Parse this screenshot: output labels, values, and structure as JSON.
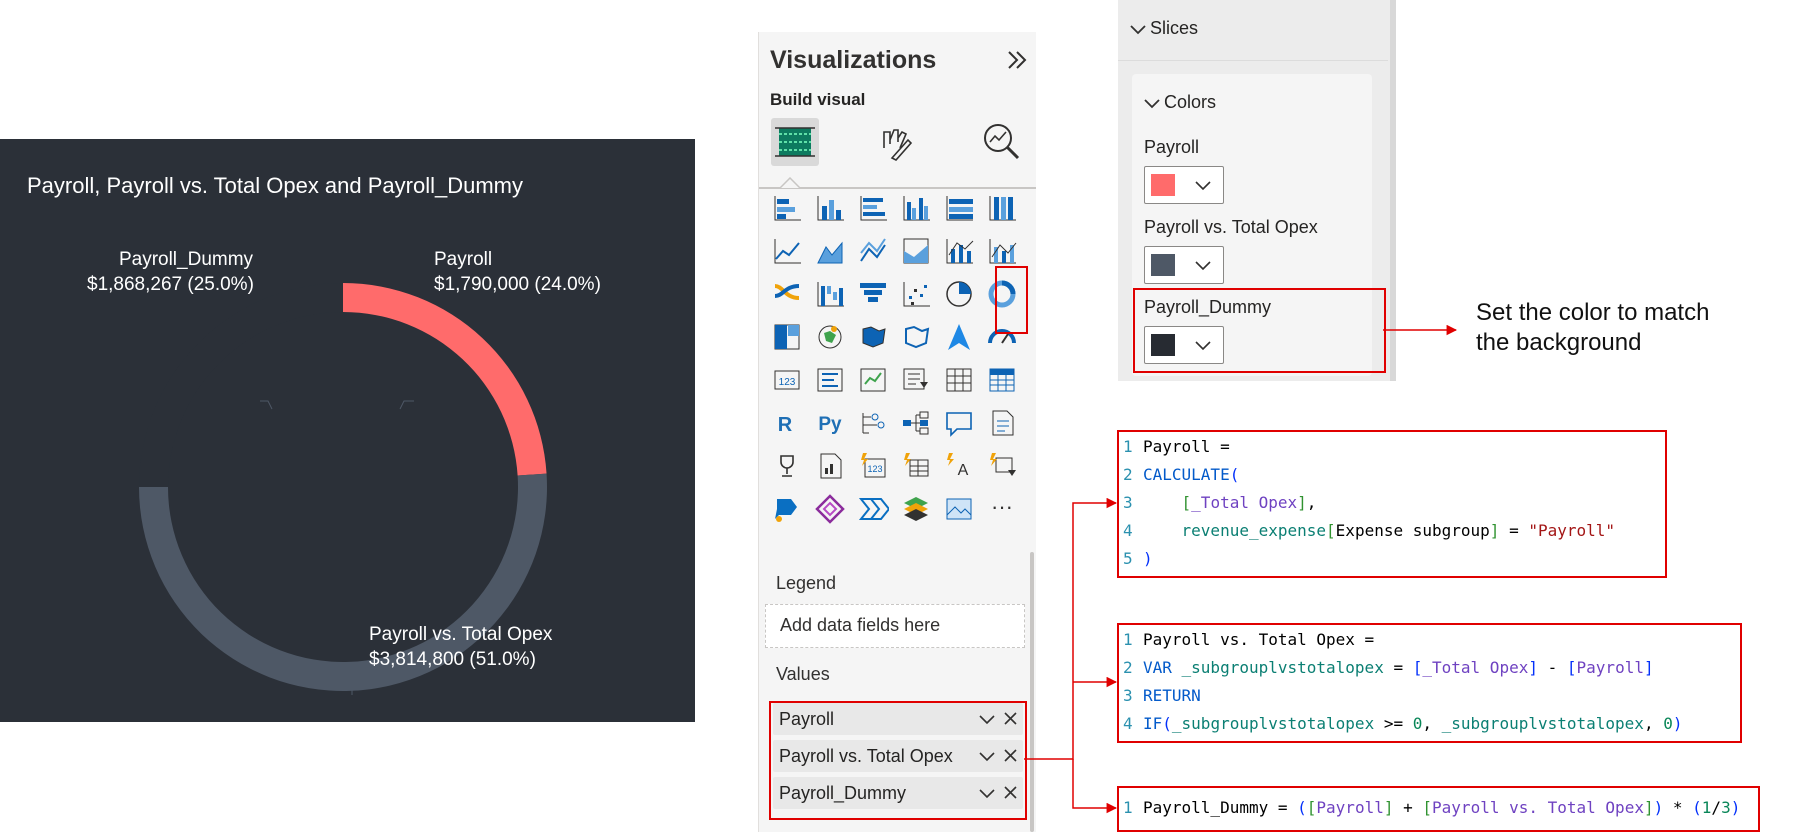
{
  "chart": {
    "title": "Payroll, Payroll vs. Total Opex and Payroll_Dummy",
    "labels": {
      "payroll_dummy": {
        "name": "Payroll_Dummy",
        "value": "$1,868,267 (25.0%)"
      },
      "payroll": {
        "name": "Payroll",
        "value": "$1,790,000 (24.0%)"
      },
      "payroll_vs_opex": {
        "name": "Payroll vs. Total Opex",
        "value": "$3,814,800 (51.0%)"
      }
    }
  },
  "chart_data": {
    "type": "pie",
    "title": "Payroll, Payroll vs. Total Opex and Payroll_Dummy",
    "categories": [
      "Payroll",
      "Payroll vs. Total Opex",
      "Payroll_Dummy"
    ],
    "values": [
      1790000,
      3814800,
      1868267
    ],
    "percentages": [
      24.0,
      51.0,
      25.0
    ],
    "colors": [
      "#ff6b6b",
      "#4e5866",
      "#2b3038"
    ],
    "legend": "none"
  },
  "viz_pane": {
    "title": "Visualizations",
    "build_visual": "Build visual",
    "legend_label": "Legend",
    "add_fields": "Add data fields here",
    "values_label": "Values",
    "value_fields": [
      "Payroll",
      "Payroll vs. Total Opex",
      "Payroll_Dummy"
    ],
    "more": "···",
    "icon_r": "R",
    "icon_py": "Py",
    "icon_123": "123"
  },
  "format_pane": {
    "slices": "Slices",
    "colors": "Colors",
    "items": [
      {
        "label": "Payroll",
        "color": "#ff6b6b"
      },
      {
        "label": "Payroll vs. Total Opex",
        "color": "#4e5866"
      },
      {
        "label": "Payroll_Dummy",
        "color": "#272b32"
      }
    ]
  },
  "annotation": {
    "line1": "Set the color to match",
    "line2": "the background"
  },
  "code": {
    "block1": {
      "lines": [
        {
          "n": "1",
          "segs": [
            [
              "p",
              "Payroll ="
            ]
          ]
        },
        {
          "n": "2",
          "segs": [
            [
              "f",
              "CALCULATE"
            ],
            [
              "b1",
              "("
            ]
          ]
        },
        {
          "n": "3",
          "segs": [
            [
              "p",
              "    "
            ],
            [
              "b2",
              "["
            ],
            [
              "m",
              "_Total Opex"
            ],
            [
              "b2",
              "]"
            ],
            [
              "p",
              ","
            ]
          ]
        },
        {
          "n": "4",
          "segs": [
            [
              "p",
              "    "
            ],
            [
              "t",
              "revenue_expense"
            ],
            [
              "b2",
              "["
            ],
            [
              "p",
              "Expense subgroup"
            ],
            [
              "b2",
              "]"
            ],
            [
              "p",
              " = "
            ],
            [
              "s",
              "\"Payroll\""
            ]
          ]
        },
        {
          "n": "5",
          "segs": [
            [
              "b1",
              ")"
            ]
          ]
        }
      ]
    },
    "block2": {
      "lines": [
        {
          "n": "1",
          "segs": [
            [
              "p",
              "Payroll vs. Total Opex ="
            ]
          ]
        },
        {
          "n": "2",
          "segs": [
            [
              "k",
              "VAR "
            ],
            [
              "t",
              "_subgrouplvstotalopex"
            ],
            [
              "p",
              " = "
            ],
            [
              "b1",
              "["
            ],
            [
              "m",
              "_Total Opex"
            ],
            [
              "b1",
              "]"
            ],
            [
              "p",
              " - "
            ],
            [
              "b1",
              "["
            ],
            [
              "m",
              "Payroll"
            ],
            [
              "b1",
              "]"
            ]
          ]
        },
        {
          "n": "3",
          "segs": [
            [
              "k",
              "RETURN"
            ]
          ]
        },
        {
          "n": "4",
          "segs": [
            [
              "f",
              "IF"
            ],
            [
              "b1",
              "("
            ],
            [
              "t",
              "_subgrouplvstotalopex"
            ],
            [
              "p",
              " >= "
            ],
            [
              "n",
              "0"
            ],
            [
              "p",
              ", "
            ],
            [
              "t",
              "_subgrouplvstotalopex"
            ],
            [
              "p",
              ", "
            ],
            [
              "n",
              "0"
            ],
            [
              "b1",
              ")"
            ]
          ]
        }
      ]
    },
    "block3": {
      "lines": [
        {
          "n": "1",
          "segs": [
            [
              "p",
              "Payroll_Dummy = "
            ],
            [
              "b1",
              "("
            ],
            [
              "b2",
              "["
            ],
            [
              "m",
              "Payroll"
            ],
            [
              "b2",
              "]"
            ],
            [
              "p",
              " + "
            ],
            [
              "b2",
              "["
            ],
            [
              "m",
              "Payroll vs. Total Opex"
            ],
            [
              "b2",
              "]"
            ],
            [
              "b1",
              ")"
            ],
            [
              "p",
              " * "
            ],
            [
              "b1",
              "("
            ],
            [
              "n",
              "1"
            ],
            [
              "p",
              "/"
            ],
            [
              "n",
              "3"
            ],
            [
              "b1",
              ")"
            ]
          ]
        }
      ]
    }
  }
}
